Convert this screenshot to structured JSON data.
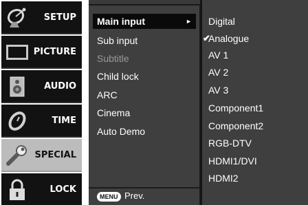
{
  "left_menu": [
    {
      "label": "SETUP",
      "icon": "satellite-dish-icon",
      "selected": false
    },
    {
      "label": "PICTURE",
      "icon": "tv-screen-icon",
      "selected": false
    },
    {
      "label": "AUDIO",
      "icon": "speaker-icon",
      "selected": false
    },
    {
      "label": "TIME",
      "icon": "clock-icon",
      "selected": false
    },
    {
      "label": "SPECIAL",
      "icon": "wrench-icon",
      "selected": true
    },
    {
      "label": "LOCK",
      "icon": "padlock-icon",
      "selected": false
    }
  ],
  "submenu": {
    "items": [
      {
        "label": "Main input",
        "state": "highlighted",
        "arrow": "►"
      },
      {
        "label": "Sub input",
        "state": "normal"
      },
      {
        "label": "Subtitle",
        "state": "disabled"
      },
      {
        "label": "Child lock",
        "state": "normal"
      },
      {
        "label": "ARC",
        "state": "normal"
      },
      {
        "label": "Cinema",
        "state": "normal"
      },
      {
        "label": "Auto Demo",
        "state": "normal"
      }
    ],
    "footer": {
      "key_label": "MENU",
      "action_label": "Prev."
    }
  },
  "options": {
    "check_mark": "✔",
    "selected_index": 1,
    "items": [
      "Digital",
      "Analogue",
      "AV 1",
      "AV 2",
      "AV 3",
      "Component1",
      "Component2",
      "RGB-DTV",
      "HDMI1/DVI",
      "HDMI2"
    ]
  },
  "colors": {
    "panel": "#3f3f3f",
    "highlight": "#0a0a0a",
    "selected_tab": "#bcbcbc",
    "tab": "#121212"
  }
}
